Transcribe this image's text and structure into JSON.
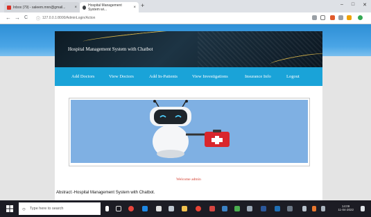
{
  "browser": {
    "tabs": [
      {
        "label": "Inbox (79) - saleem.mnn@gmail...",
        "close": "×"
      },
      {
        "label": "Hospital Management System wi...",
        "close": "×"
      }
    ],
    "new_tab": "+",
    "window_controls": [
      "–",
      "□",
      "✕"
    ],
    "back": "←",
    "forward": "→",
    "reload": "C",
    "url": "127.0.0.1:8000/AdminLogin/Action"
  },
  "site": {
    "title": "Hospital Management System with Chatbot",
    "nav": [
      "Add Doctors",
      "View Doctors",
      "Add In-Patients",
      "View Investigations",
      "Insurance Info",
      "Logout"
    ],
    "welcome": "Welcome admin"
  },
  "caption": "Abstract:-Hospital Management System with Chatbot.",
  "taskbar": {
    "search_placeholder": "Type here to search",
    "time": "14:09",
    "date": "11-04-2022"
  },
  "colors": {
    "nav_bar": "#1aa3d8",
    "header_bg": "#0d1b24",
    "welcome_text": "#d33b2c",
    "image_bg": "#7fb0e3",
    "banner": "#2e8fd6"
  }
}
